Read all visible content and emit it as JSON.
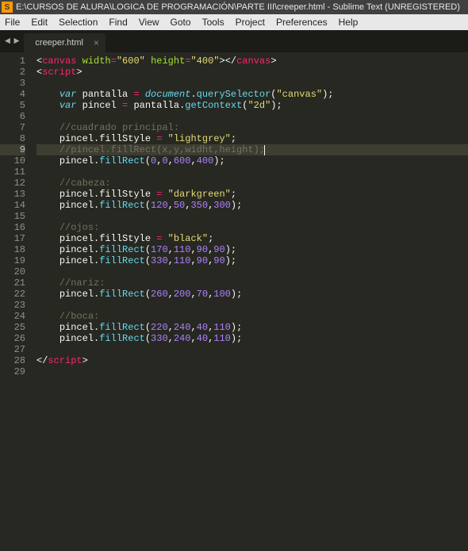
{
  "titlebar": {
    "icon_letter": "S",
    "text": "E:\\CURSOS DE ALURA\\LOGICA DE PROGRAMACIÓN\\PARTE III\\creeper.html - Sublime Text (UNREGISTERED)"
  },
  "menubar": {
    "items": [
      "File",
      "Edit",
      "Selection",
      "Find",
      "View",
      "Goto",
      "Tools",
      "Project",
      "Preferences",
      "Help"
    ]
  },
  "nav": {
    "left": "◄",
    "right": "►"
  },
  "tab": {
    "name": "creeper.html",
    "close": "×"
  },
  "active_line": 9,
  "line_count": 29,
  "code": {
    "l1": {
      "a": "canvas",
      "b": "width",
      "c": "\"600\"",
      "d": "height",
      "e": "\"400\"",
      "f": "canvas"
    },
    "l2": {
      "a": "script"
    },
    "l4": {
      "kw": "var",
      "v": "pantalla",
      "obj": "document",
      "fn": "querySelector",
      "arg": "\"canvas\""
    },
    "l5": {
      "kw": "var",
      "v": "pincel",
      "obj": "pantalla",
      "fn": "getContext",
      "arg": "\"2d\""
    },
    "l7": {
      "c": "//cuadrado principal:"
    },
    "l8": {
      "obj": "pincel",
      "prop": "fillStyle",
      "val": "\"lightgrey\""
    },
    "l9": {
      "c": "//pincel.fillRect(x,y,widht,height);"
    },
    "l10": {
      "obj": "pincel",
      "fn": "fillRect",
      "a": "0",
      "b": "0",
      "c": "600",
      "d": "400"
    },
    "l12": {
      "c": "//cabeza:"
    },
    "l13": {
      "obj": "pincel",
      "prop": "fillStyle",
      "val": "\"darkgreen\""
    },
    "l14": {
      "obj": "pincel",
      "fn": "fillRect",
      "a": "120",
      "b": "50",
      "c": "350",
      "d": "300"
    },
    "l16": {
      "c": "//ojos:"
    },
    "l17": {
      "obj": "pincel",
      "prop": "fillStyle",
      "val": "\"black\""
    },
    "l18": {
      "obj": "pincel",
      "fn": "fillRect",
      "a": "170",
      "b": "110",
      "c": "90",
      "d": "90"
    },
    "l19": {
      "obj": "pincel",
      "fn": "fillRect",
      "a": "330",
      "b": "110",
      "c": "90",
      "d": "90"
    },
    "l21": {
      "c": "//nariz:"
    },
    "l22": {
      "obj": "pincel",
      "fn": "fillRect",
      "a": "260",
      "b": "200",
      "c": "70",
      "d": "100"
    },
    "l24": {
      "c": "//boca:"
    },
    "l25": {
      "obj": "pincel",
      "fn": "fillRect",
      "a": "220",
      "b": "240",
      "c": "40",
      "d": "110"
    },
    "l26": {
      "obj": "pincel",
      "fn": "fillRect",
      "a": "330",
      "b": "240",
      "c": "40",
      "d": "110"
    },
    "l28": {
      "a": "script"
    }
  }
}
